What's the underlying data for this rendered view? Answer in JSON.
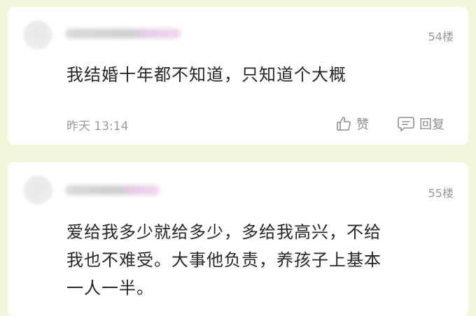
{
  "comments": [
    {
      "floor": "54楼",
      "content": "我结婚十年都不知道，只知道个大概",
      "time": "昨天 13:14",
      "like_label": "赞",
      "reply_label": "回复"
    },
    {
      "floor": "55楼",
      "content_lines": [
        "爱给我多少就给多少，多给我高兴，不给",
        "我也不难受。大事他负责，养孩子上基本",
        "一人一半。"
      ]
    }
  ],
  "icons": {
    "like": "thumbs-up-icon",
    "reply": "comment-bubble-icon"
  },
  "colors": {
    "background": "#f4f6dc",
    "card": "#ffffff",
    "text": "#262626",
    "muted": "#9a9a9a"
  }
}
